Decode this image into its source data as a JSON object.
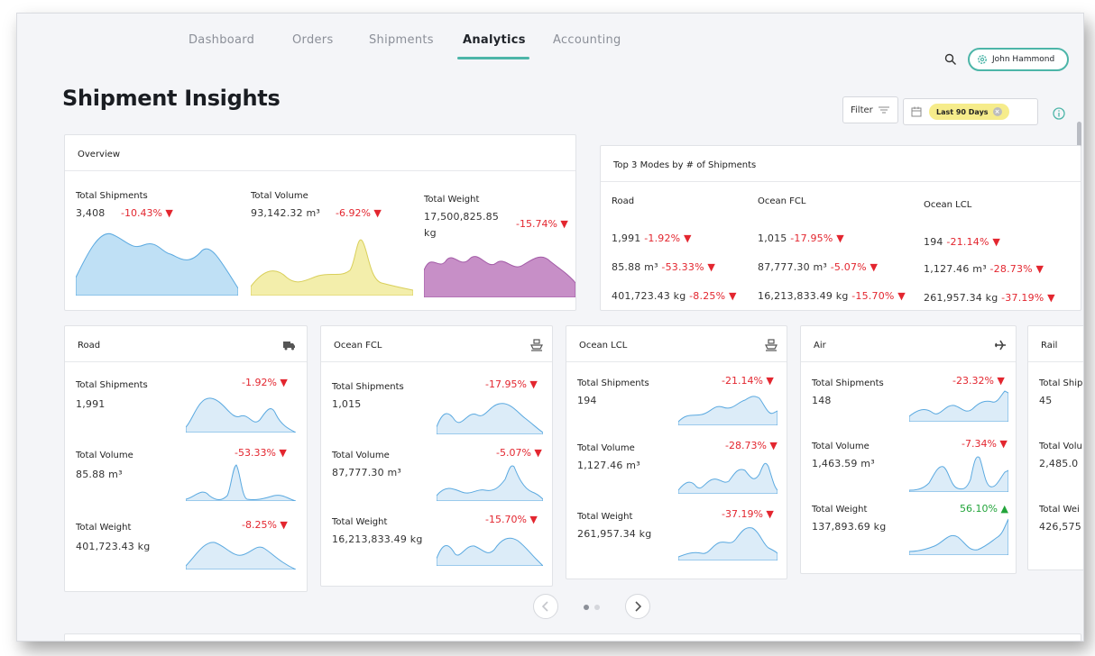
{
  "nav": {
    "tabs": [
      {
        "label": "Dashboard"
      },
      {
        "label": "Orders"
      },
      {
        "label": "Shipments"
      },
      {
        "label": "Analytics"
      },
      {
        "label": "Accounting"
      }
    ],
    "active_tab": "Analytics",
    "user_name": "John Hammond",
    "icons": {
      "search": "search-icon",
      "settings": "gear-icon"
    }
  },
  "page": {
    "title": "Shipment Insights",
    "filter_label": "Filter",
    "date_range": "Last 90 Days"
  },
  "overview": {
    "title": "Overview",
    "metrics": [
      {
        "label": "Total Shipments",
        "value": "3,408",
        "delta": "-10.43%",
        "color": "#bfe0f5"
      },
      {
        "label": "Total Volume",
        "value": "93,142.32 m³",
        "delta": "-6.92%",
        "color": "#f3eeab"
      },
      {
        "label": "Total Weight",
        "value": "17,500,825.85",
        "unit": "kg",
        "delta": "-15.74%",
        "color": "#c78fc7"
      }
    ]
  },
  "top_modes": {
    "title": "Top 3 Modes by # of Shipments",
    "modes": [
      {
        "name": "Road",
        "shipments": "1,991",
        "shipments_delta": "-1.92%",
        "volume": "85.88 m³",
        "volume_delta": "-53.33%",
        "weight": "401,723.43 kg",
        "weight_delta": "-8.25%"
      },
      {
        "name": "Ocean FCL",
        "shipments": "1,015",
        "shipments_delta": "-17.95%",
        "volume": "87,777.30 m³",
        "volume_delta": "-5.07%",
        "weight": "16,213,833.49 kg",
        "weight_delta": "-15.70%"
      },
      {
        "name": "Ocean LCL",
        "shipments": "194",
        "shipments_delta": "-21.14%",
        "volume": "1,127.46 m³",
        "volume_delta": "-28.73%",
        "weight": "261,957.34 kg",
        "weight_delta": "-37.19%"
      }
    ]
  },
  "mode_cards": [
    {
      "name": "Road",
      "icon": "truck-icon",
      "metrics": [
        {
          "label": "Total Shipments",
          "value": "1,991",
          "delta": "-1.92%",
          "trend": "down"
        },
        {
          "label": "Total Volume",
          "value": "85.88 m³",
          "delta": "-53.33%",
          "trend": "down"
        },
        {
          "label": "Total Weight",
          "value": "401,723.43 kg",
          "delta": "-8.25%",
          "trend": "down"
        }
      ]
    },
    {
      "name": "Ocean FCL",
      "icon": "ship-icon",
      "metrics": [
        {
          "label": "Total Shipments",
          "value": "1,015",
          "delta": "-17.95%",
          "trend": "down"
        },
        {
          "label": "Total Volume",
          "value": "87,777.30 m³",
          "delta": "-5.07%",
          "trend": "down"
        },
        {
          "label": "Total Weight",
          "value": "16,213,833.49 kg",
          "delta": "-15.70%",
          "trend": "down"
        }
      ]
    },
    {
      "name": "Ocean LCL",
      "icon": "ship-icon",
      "metrics": [
        {
          "label": "Total Shipments",
          "value": "194",
          "delta": "-21.14%",
          "trend": "down"
        },
        {
          "label": "Total Volume",
          "value": "1,127.46 m³",
          "delta": "-28.73%",
          "trend": "down"
        },
        {
          "label": "Total Weight",
          "value": "261,957.34 kg",
          "delta": "-37.19%",
          "trend": "down"
        }
      ]
    },
    {
      "name": "Air",
      "icon": "plane-icon",
      "metrics": [
        {
          "label": "Total Shipments",
          "value": "148",
          "delta": "-23.32%",
          "trend": "down"
        },
        {
          "label": "Total Volume",
          "value": "1,463.59 m³",
          "delta": "-7.34%",
          "trend": "down"
        },
        {
          "label": "Total Weight",
          "value": "137,893.69 kg",
          "delta": "56.10%",
          "trend": "up"
        }
      ]
    },
    {
      "name": "Rail",
      "icon": "",
      "metrics": [
        {
          "label": "Total Ship",
          "value": "45"
        },
        {
          "label": "Total Volu",
          "value": "2,485.0"
        },
        {
          "label": "Total Wei",
          "value": "426,575"
        }
      ]
    }
  ],
  "pager": {
    "pages": 2,
    "current": 1
  },
  "colors": {
    "accent": "#4cb5a8",
    "negative": "#e3262f",
    "positive": "#22a43a",
    "spark": "#bfe0f5",
    "spark_line": "#5aa9e0"
  }
}
